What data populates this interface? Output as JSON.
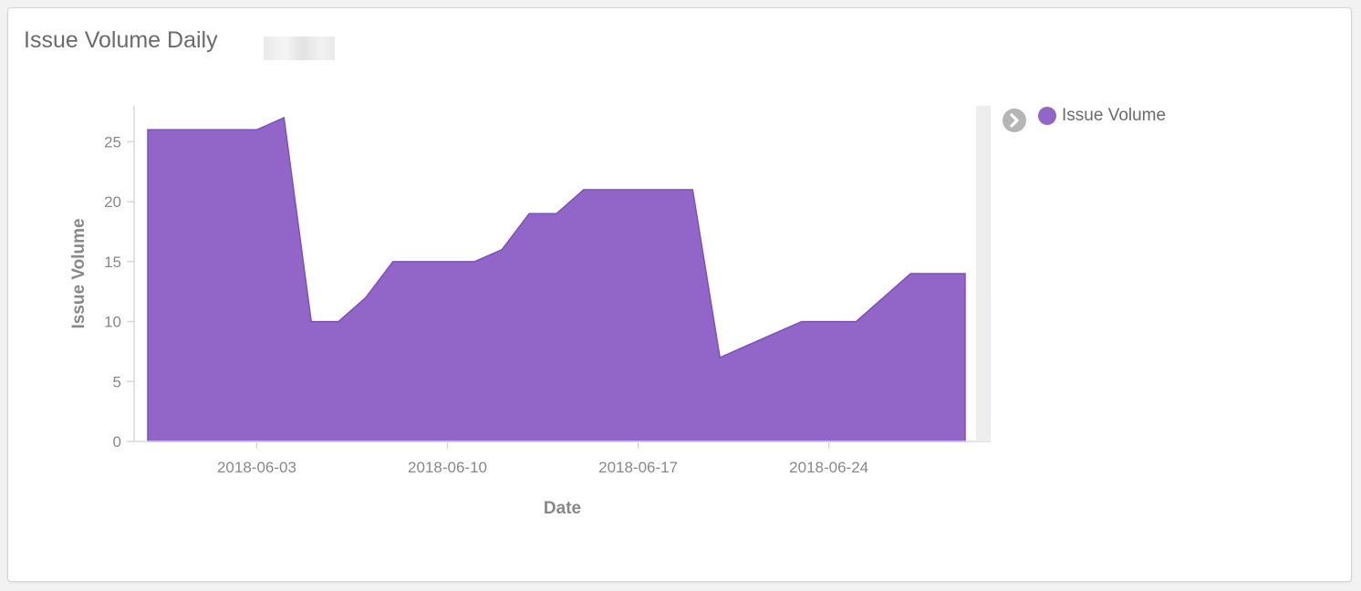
{
  "panel": {
    "title": "Issue Volume Daily"
  },
  "legend": {
    "items": [
      {
        "label": "Issue Volume",
        "color": "#9266c8"
      }
    ],
    "toggle_icon": "chevron-right-circle-icon"
  },
  "chart_data": {
    "type": "area",
    "title": "Issue Volume Daily",
    "xlabel": "Date",
    "ylabel": "Issue Volume",
    "ylim": [
      0,
      27
    ],
    "yticks": [
      0,
      5,
      10,
      15,
      20,
      25
    ],
    "xticks": [
      "2018-06-03",
      "2018-06-10",
      "2018-06-17",
      "2018-06-24"
    ],
    "grid": false,
    "legend_position": "right",
    "series": [
      {
        "name": "Issue Volume",
        "color": "#9266c8",
        "x": [
          "2018-05-30",
          "2018-05-31",
          "2018-06-01",
          "2018-06-02",
          "2018-06-03",
          "2018-06-04",
          "2018-06-05",
          "2018-06-06",
          "2018-06-07",
          "2018-06-08",
          "2018-06-09",
          "2018-06-10",
          "2018-06-11",
          "2018-06-12",
          "2018-06-13",
          "2018-06-14",
          "2018-06-15",
          "2018-06-16",
          "2018-06-17",
          "2018-06-18",
          "2018-06-19",
          "2018-06-20",
          "2018-06-21",
          "2018-06-22",
          "2018-06-23",
          "2018-06-24",
          "2018-06-25",
          "2018-06-26",
          "2018-06-27",
          "2018-06-28",
          "2018-06-29"
        ],
        "values": [
          26,
          26,
          26,
          26,
          26,
          27,
          10,
          10,
          12,
          15,
          15,
          15,
          15,
          16,
          19,
          19,
          21,
          21,
          21,
          21,
          21,
          7,
          8,
          9,
          10,
          10,
          10,
          12,
          14,
          14,
          14
        ]
      }
    ]
  }
}
